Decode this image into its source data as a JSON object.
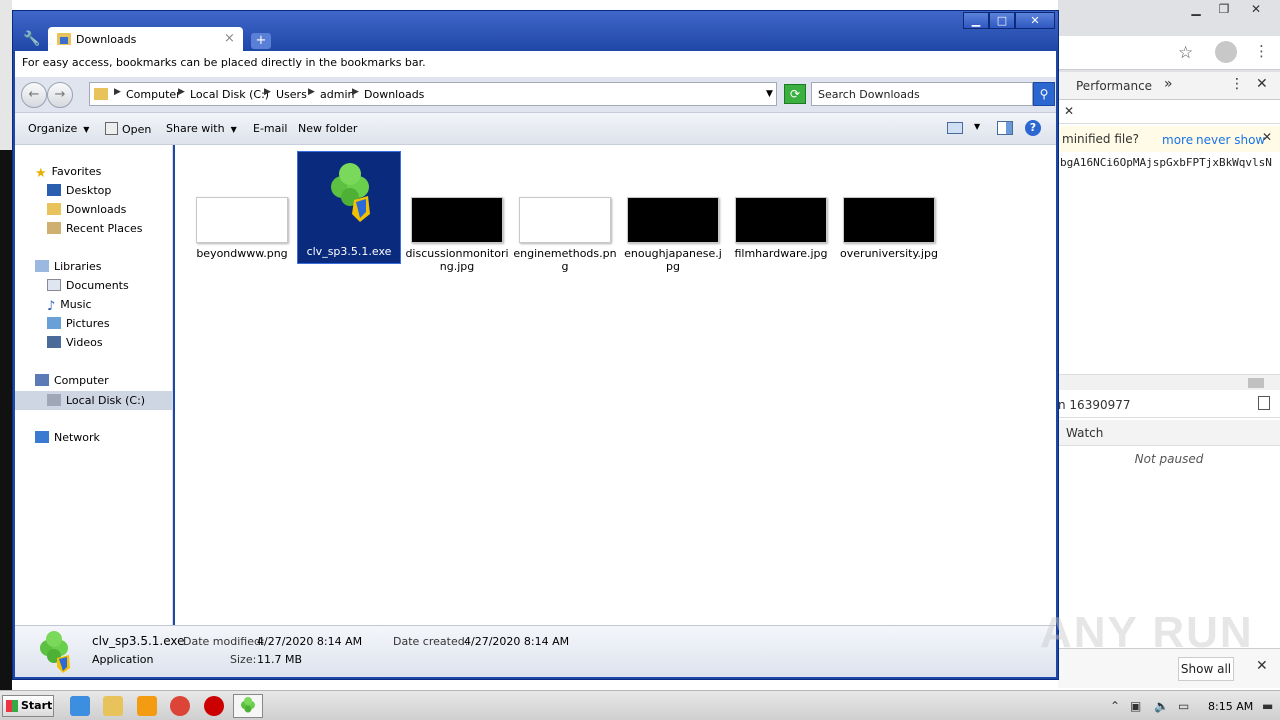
{
  "explorer": {
    "tab_title": "Downloads",
    "bookmarks_message": "For easy access, bookmarks can be placed directly in the bookmarks bar.",
    "breadcrumbs": [
      "Computer",
      "Local Disk (C:)",
      "Users",
      "admin",
      "Downloads"
    ],
    "search_placeholder": "Search Downloads",
    "toolbar": {
      "organize": "Organize",
      "open": "Open",
      "share_with": "Share with",
      "email": "E-mail",
      "new_folder": "New folder"
    },
    "nav": {
      "favorites": "Favorites",
      "desktop": "Desktop",
      "downloads": "Downloads",
      "recent_places": "Recent Places",
      "libraries": "Libraries",
      "documents": "Documents",
      "music": "Music",
      "pictures": "Pictures",
      "videos": "Videos",
      "computer": "Computer",
      "local_disk": "Local Disk (C:)",
      "network": "Network"
    },
    "files": [
      {
        "name": "beyondwww.png"
      },
      {
        "name": "clv_sp3.5.1.exe"
      },
      {
        "name": "discussionmonitoring.jpg"
      },
      {
        "name": "enginemethods.png"
      },
      {
        "name": "enoughjapanese.jpg"
      },
      {
        "name": "filmhardware.jpg"
      },
      {
        "name": "overuniversity.jpg"
      }
    ],
    "details": {
      "filename": "clv_sp3.5.1.exe",
      "type": "Application",
      "date_modified_label": "Date modified:",
      "date_modified": "4/27/2020 8:14 AM",
      "date_created_label": "Date created:",
      "date_created": "4/27/2020 8:14 AM",
      "size_label": "Size:",
      "size": "11.7 MB"
    }
  },
  "devtools": {
    "tab_performance": "Performance",
    "more_tabs": "»",
    "minified_question": "minified file?",
    "more_link": "more",
    "never_show_link": "never show",
    "code_line": "bgA16NCi6OpMAjspGxbFPTjxBkWqvlsN",
    "id_text": "n 16390977",
    "watch": "Watch",
    "not_paused": "Not paused",
    "show_all": "Show all"
  },
  "taskbar": {
    "start": "Start",
    "clock": "8:15 AM"
  },
  "watermark": "ANY RUN"
}
